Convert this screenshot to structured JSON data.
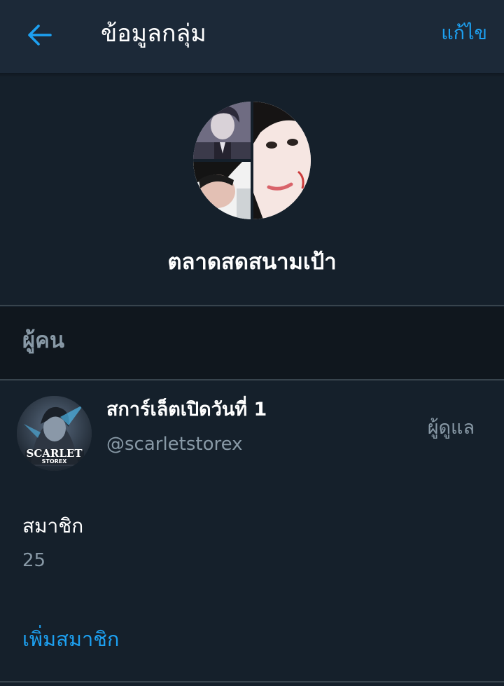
{
  "header": {
    "title": "ข้อมูลกลุ่ม",
    "edit_label": "แก้ไข",
    "back_icon": "arrow-left-icon"
  },
  "group": {
    "name": "ตลาดสดสนามเป้า",
    "avatar_icon": "group-avatar-collage"
  },
  "people_section": {
    "title": "ผู้คน",
    "members": [
      {
        "display_name": "สการ์เล็ตเปิดวันที่ 1",
        "handle": "@scarletstorex",
        "role": "ผู้ดูแล",
        "avatar_text_line1": "SCARLET",
        "avatar_text_line2": "STOREX"
      }
    ]
  },
  "members_info": {
    "label": "สมาชิก",
    "count": "25"
  },
  "actions": {
    "add_members_label": "เพิ่มสมาชิก"
  },
  "colors": {
    "background": "#15202b",
    "header_background": "#1c2938",
    "section_background": "#10171e",
    "accent": "#1da1f2",
    "secondary_text": "#8899a6",
    "divider": "#38444d"
  }
}
